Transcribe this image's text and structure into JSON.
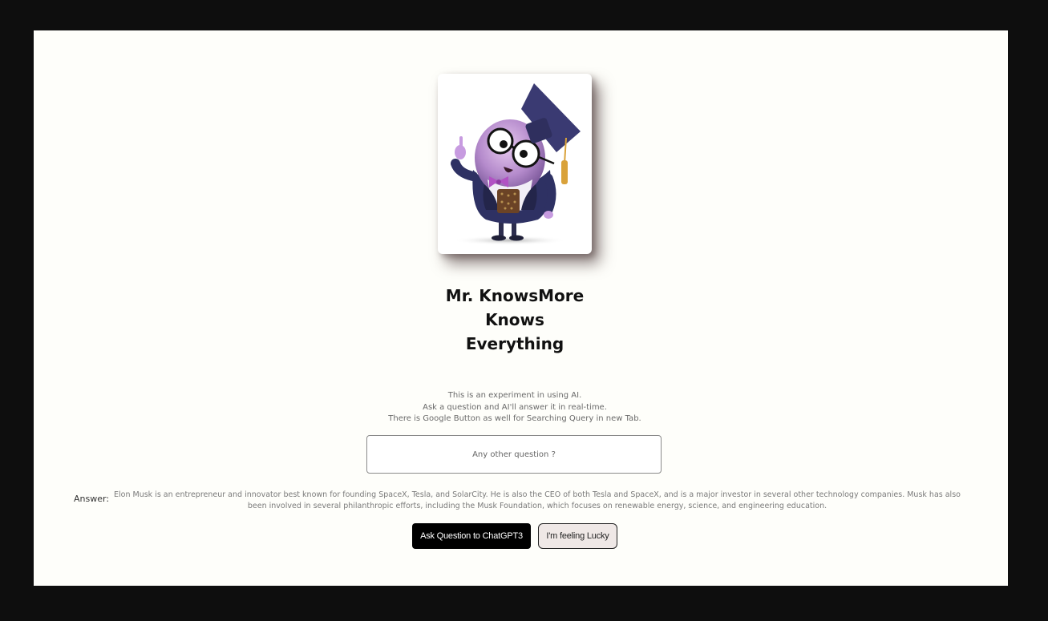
{
  "hero": {
    "image_icon": "professor-mascot-image",
    "title_lines": [
      "Mr. KnowsMore",
      "Knows",
      "Everything"
    ]
  },
  "description": {
    "lines": [
      "This is an experiment in using AI.",
      "Ask a question and AI'll answer it in real-time.",
      "There is Google Button as well for Searching Query in new Tab."
    ]
  },
  "search": {
    "placeholder": "Any other question ?",
    "value": ""
  },
  "answer": {
    "label": "Answer:",
    "text": "Elon Musk is an entrepreneur and innovator best known for founding SpaceX, Tesla, and SolarCity. He is also the CEO of both Tesla and SpaceX, and is a major investor in several other technology companies. Musk has also been involved in several philanthropic efforts, including the Musk Foundation, which focuses on renewable energy, science, and engineering education."
  },
  "buttons": {
    "ask_label": "Ask Question to ChatGPT3",
    "lucky_label": "I'm feeling Lucky"
  },
  "colors": {
    "page_background": "#fefefa",
    "frame_background": "#0e0e0e",
    "ask_button_background": "#000000",
    "lucky_button_background": "#efe8e6"
  }
}
